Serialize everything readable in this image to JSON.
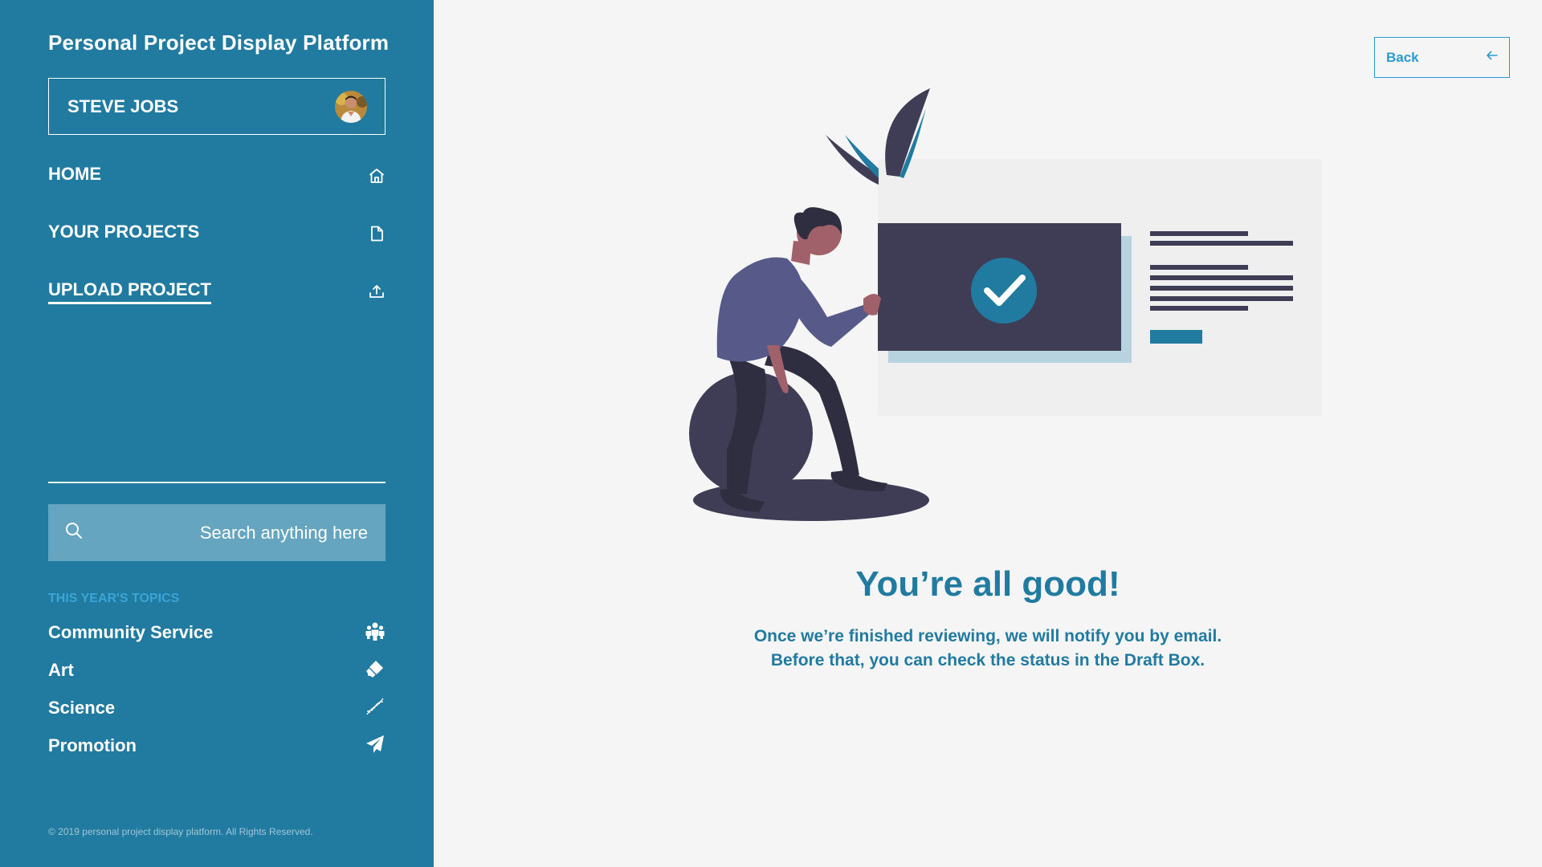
{
  "sidebar": {
    "app_title": "Personal Project Display Platform",
    "user": {
      "name": "STEVE JOBS"
    },
    "nav": [
      {
        "label": "HOME",
        "icon": "home-icon"
      },
      {
        "label": "YOUR PROJECTS",
        "icon": "document-icon"
      },
      {
        "label": "UPLOAD PROJECT",
        "icon": "upload-icon",
        "active": true
      }
    ],
    "search": {
      "placeholder": "Search anything here"
    },
    "topics": {
      "heading": "THIS YEAR'S TOPICS",
      "items": [
        {
          "label": "Community Service",
          "icon": "people-icon"
        },
        {
          "label": "Art",
          "icon": "paintbrush-icon"
        },
        {
          "label": "Science",
          "icon": "dna-icon"
        },
        {
          "label": "Promotion",
          "icon": "paper-plane-icon"
        }
      ]
    },
    "footer": "© 2019 personal project display platform. All Rights Reserved."
  },
  "main": {
    "back_label": "Back",
    "headline": "You’re all good!",
    "message_line1": "Once we’re finished reviewing, we will notify you by email.",
    "message_line2": "Before that, you can check the status in the Draft Box."
  },
  "colors": {
    "sidebar_bg": "#217a9f",
    "accent": "#2a9bd1",
    "search_bg": "#66a5bf",
    "main_bg": "#f5f5f5",
    "illustration_dark": "#3f3d56"
  }
}
